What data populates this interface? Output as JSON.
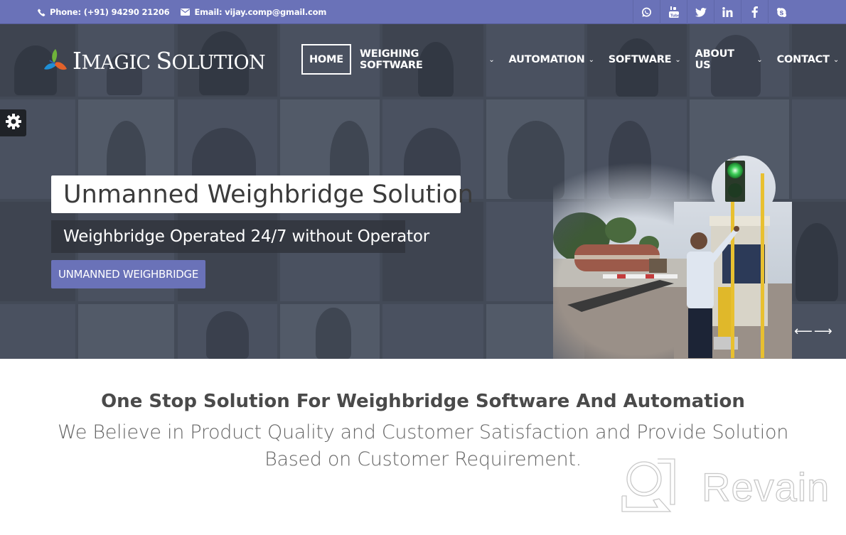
{
  "topbar": {
    "phone_label": "Phone: (+91) 94290 21206",
    "email_label": "Email: vijay.comp@gmail.com",
    "phone_icon": "phone-icon",
    "email_icon": "envelope-icon",
    "social": [
      "whatsapp-icon",
      "youtube-icon",
      "twitter-icon",
      "linkedin-icon",
      "facebook-icon",
      "skype-icon"
    ]
  },
  "brand": {
    "name_part1": "I",
    "name_part1_rest": "MAGIC ",
    "name_part2": "S",
    "name_part2_rest": "OLUTION"
  },
  "nav": {
    "items": [
      {
        "label": "HOME",
        "active": true
      },
      {
        "label": "WEIGHING SOFTWARE",
        "dropdown": true
      },
      {
        "label": "AUTOMATION",
        "dropdown": true
      },
      {
        "label": "SOFTWARE",
        "dropdown": true
      },
      {
        "label": "ABOUT US",
        "dropdown": true
      },
      {
        "label": "CONTACT",
        "dropdown": true
      }
    ],
    "chevron": "⌄"
  },
  "hero": {
    "title": "Unmanned Weighbridge Solution",
    "subtitle": "Weighbridge Operated 24/7 without Operator",
    "button_label": "UNMANNED WEIGHBRIDGE",
    "arrows": "⟵⟶"
  },
  "intro": {
    "heading": "One Stop Solution For Weighbridge Software And Automation",
    "text": "We Believe in Product Quality and Customer Satisfaction and Provide Solution Based on Customer Requirement."
  },
  "watermark": {
    "text": "Revain"
  },
  "colors": {
    "accent": "#6a72b8",
    "hero_bg": "#434a57",
    "heading": "#4a4a4a"
  }
}
